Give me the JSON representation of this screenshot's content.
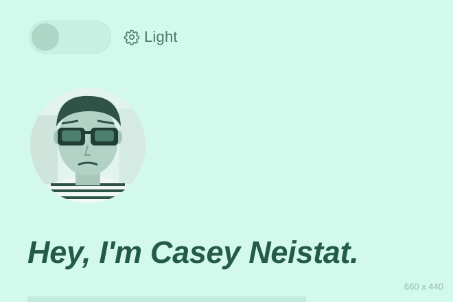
{
  "theme_toggle": {
    "state": "light",
    "label": "Light",
    "icon": "gear-icon"
  },
  "profile": {
    "avatar_alt": "avatar"
  },
  "hero": {
    "title": "Hey, I'm Casey Neistat."
  },
  "dimensions_label": "660 x 440",
  "colors": {
    "background": "#d2f9ec",
    "heading": "#245a48",
    "toggle_knob": "#aed6c7",
    "label": "#4d7a6b"
  }
}
